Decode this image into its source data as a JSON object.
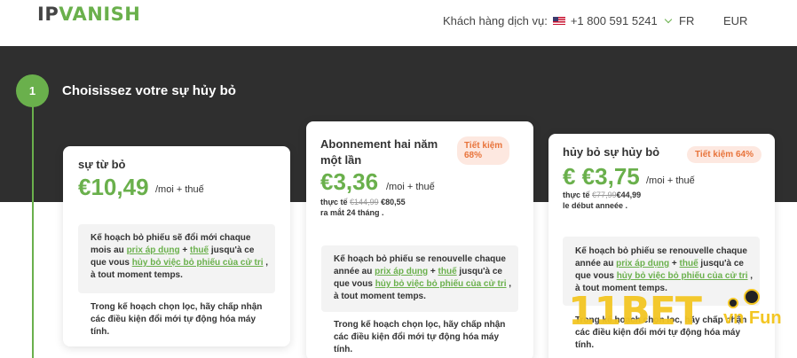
{
  "header": {
    "logo_ip": "IP",
    "logo_vanish": "VANISH",
    "support_label": "Khách hàng dịch vụ:",
    "phone": "+1 800 591 5241",
    "language": "FR",
    "currency": "EUR"
  },
  "step": {
    "number": "1",
    "title": "Choisissez votre sự hủy bỏ"
  },
  "plans": [
    {
      "name": "sự từ bỏ",
      "price": "€10,49",
      "per_month": "/moi + thuế",
      "p1_a": "Kế hoạch bỏ phiếu sẽ đổi mới chaque",
      "p1_b": "mois au ",
      "p1_link1": "prix áp dụng",
      "p1_c": " + ",
      "p1_link2": "thuế",
      "p1_d": " jusqu'à ce",
      "p1_e": "que vous ",
      "p1_link3": "hủy bỏ việc bỏ phiếu của cử tri",
      "p1_f": " ,",
      "p1_g": "à tout moment temps.",
      "p2_a": "Trong kế hoạch chọn lọc, hãy chấp nhận",
      "p2_b": "các điều kiện đổi mới tự động hóa máy",
      "p2_c": "tính."
    },
    {
      "name_line1": "Abonnement hai năm",
      "name_line2": "một lần",
      "badge_line1": "Tiết kiệm",
      "badge_line2": "68%",
      "price": "€3,36",
      "per_month": "/moi + thuế",
      "real_label": "thực tế",
      "old_price": "€144,99",
      "new_price": "€80,55",
      "period": "ra mắt 24 tháng  .",
      "p1_a": "Kế hoạch bỏ phiếu se renouvelle chaque",
      "p1_b": "année au ",
      "p1_link1": "prix áp dụng",
      "p1_c": " + ",
      "p1_link2": "thuế",
      "p1_d": " jusqu'à ce",
      "p1_e": "que vous ",
      "p1_link3": "hủy bỏ việc bỏ phiếu của cử tri",
      "p1_f": " ,",
      "p1_g": "à tout moment temps.",
      "p2_a": "Trong kế hoạch chọn lọc, hãy chấp nhận",
      "p2_b": "các điều kiện đổi mới tự động hóa máy",
      "p2_c": "tính."
    },
    {
      "name": "hủy bỏ sự hủy bỏ",
      "badge": "Tiết kiệm 64%",
      "price": "€ €3,75",
      "per_month": "/moi + thuế",
      "real_label": "thực tế",
      "old_price": "€77,99",
      "new_price": "€44,99",
      "period": "le début anneée  .",
      "p1_a": "Kế hoạch bỏ phiếu se renouvelle chaque",
      "p1_b": "année au ",
      "p1_link1": "prix áp dụng",
      "p1_c": " + ",
      "p1_link2": "thuế",
      "p1_d": " jusqu'à ce",
      "p1_e": "que vous ",
      "p1_link3": "hủy bỏ việc bỏ phiếu của cử tri",
      "p1_f": " ,",
      "p1_g": "à tout moment temps.",
      "p2_a": "Trong kế hoạch chọn lọc, hãy chấp nhận",
      "p2_b": "các điều kiện đổi mới tự động hóa máy",
      "p2_c": "tính."
    }
  ],
  "watermark": {
    "text": "11BET",
    "suffix": "vn Fun"
  },
  "colors": {
    "brand_green": "#6ab04c",
    "dark_band": "#2f2f2f",
    "badge_bg": "#fde8e0",
    "badge_text": "#e8743b"
  }
}
